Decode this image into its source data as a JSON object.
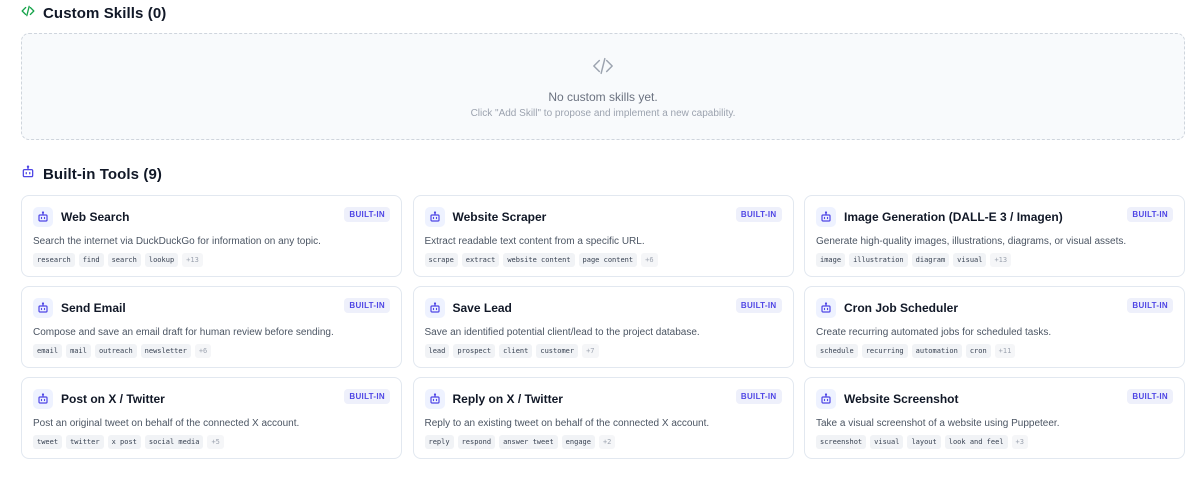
{
  "custom": {
    "title": "Custom Skills (0)",
    "empty_title": "No custom skills yet.",
    "empty_sub": "Click \"Add Skill\" to propose and implement a new capability."
  },
  "builtin": {
    "title": "Built-in Tools (9)",
    "badge": "BUILT-IN",
    "tools": [
      {
        "name": "Web Search",
        "desc": "Search the internet via DuckDuckGo for information on any topic.",
        "tags": [
          "research",
          "find",
          "search",
          "lookup"
        ],
        "more": "+13"
      },
      {
        "name": "Website Scraper",
        "desc": "Extract readable text content from a specific URL.",
        "tags": [
          "scrape",
          "extract",
          "website content",
          "page content"
        ],
        "more": "+6"
      },
      {
        "name": "Image Generation (DALL-E 3 / Imagen)",
        "desc": "Generate high-quality images, illustrations, diagrams, or visual assets.",
        "tags": [
          "image",
          "illustration",
          "diagram",
          "visual"
        ],
        "more": "+13"
      },
      {
        "name": "Send Email",
        "desc": "Compose and save an email draft for human review before sending.",
        "tags": [
          "email",
          "mail",
          "outreach",
          "newsletter"
        ],
        "more": "+6"
      },
      {
        "name": "Save Lead",
        "desc": "Save an identified potential client/lead to the project database.",
        "tags": [
          "lead",
          "prospect",
          "client",
          "customer"
        ],
        "more": "+7"
      },
      {
        "name": "Cron Job Scheduler",
        "desc": "Create recurring automated jobs for scheduled tasks.",
        "tags": [
          "schedule",
          "recurring",
          "automation",
          "cron"
        ],
        "more": "+11"
      },
      {
        "name": "Post on X / Twitter",
        "desc": "Post an original tweet on behalf of the connected X account.",
        "tags": [
          "tweet",
          "twitter",
          "x post",
          "social media"
        ],
        "more": "+5"
      },
      {
        "name": "Reply on X / Twitter",
        "desc": "Reply to an existing tweet on behalf of the connected X account.",
        "tags": [
          "reply",
          "respond",
          "answer tweet",
          "engage"
        ],
        "more": "+2"
      },
      {
        "name": "Website Screenshot",
        "desc": "Take a visual screenshot of a website using Puppeteer.",
        "tags": [
          "screenshot",
          "visual",
          "layout",
          "look and feel"
        ],
        "more": "+3"
      }
    ]
  },
  "colors": {
    "accent": "#16a34a",
    "bot": "#4f46e5",
    "badge_bg": "#eef0fb"
  },
  "icons": {
    "custom": "code-icon",
    "builtin": "bot-icon"
  }
}
